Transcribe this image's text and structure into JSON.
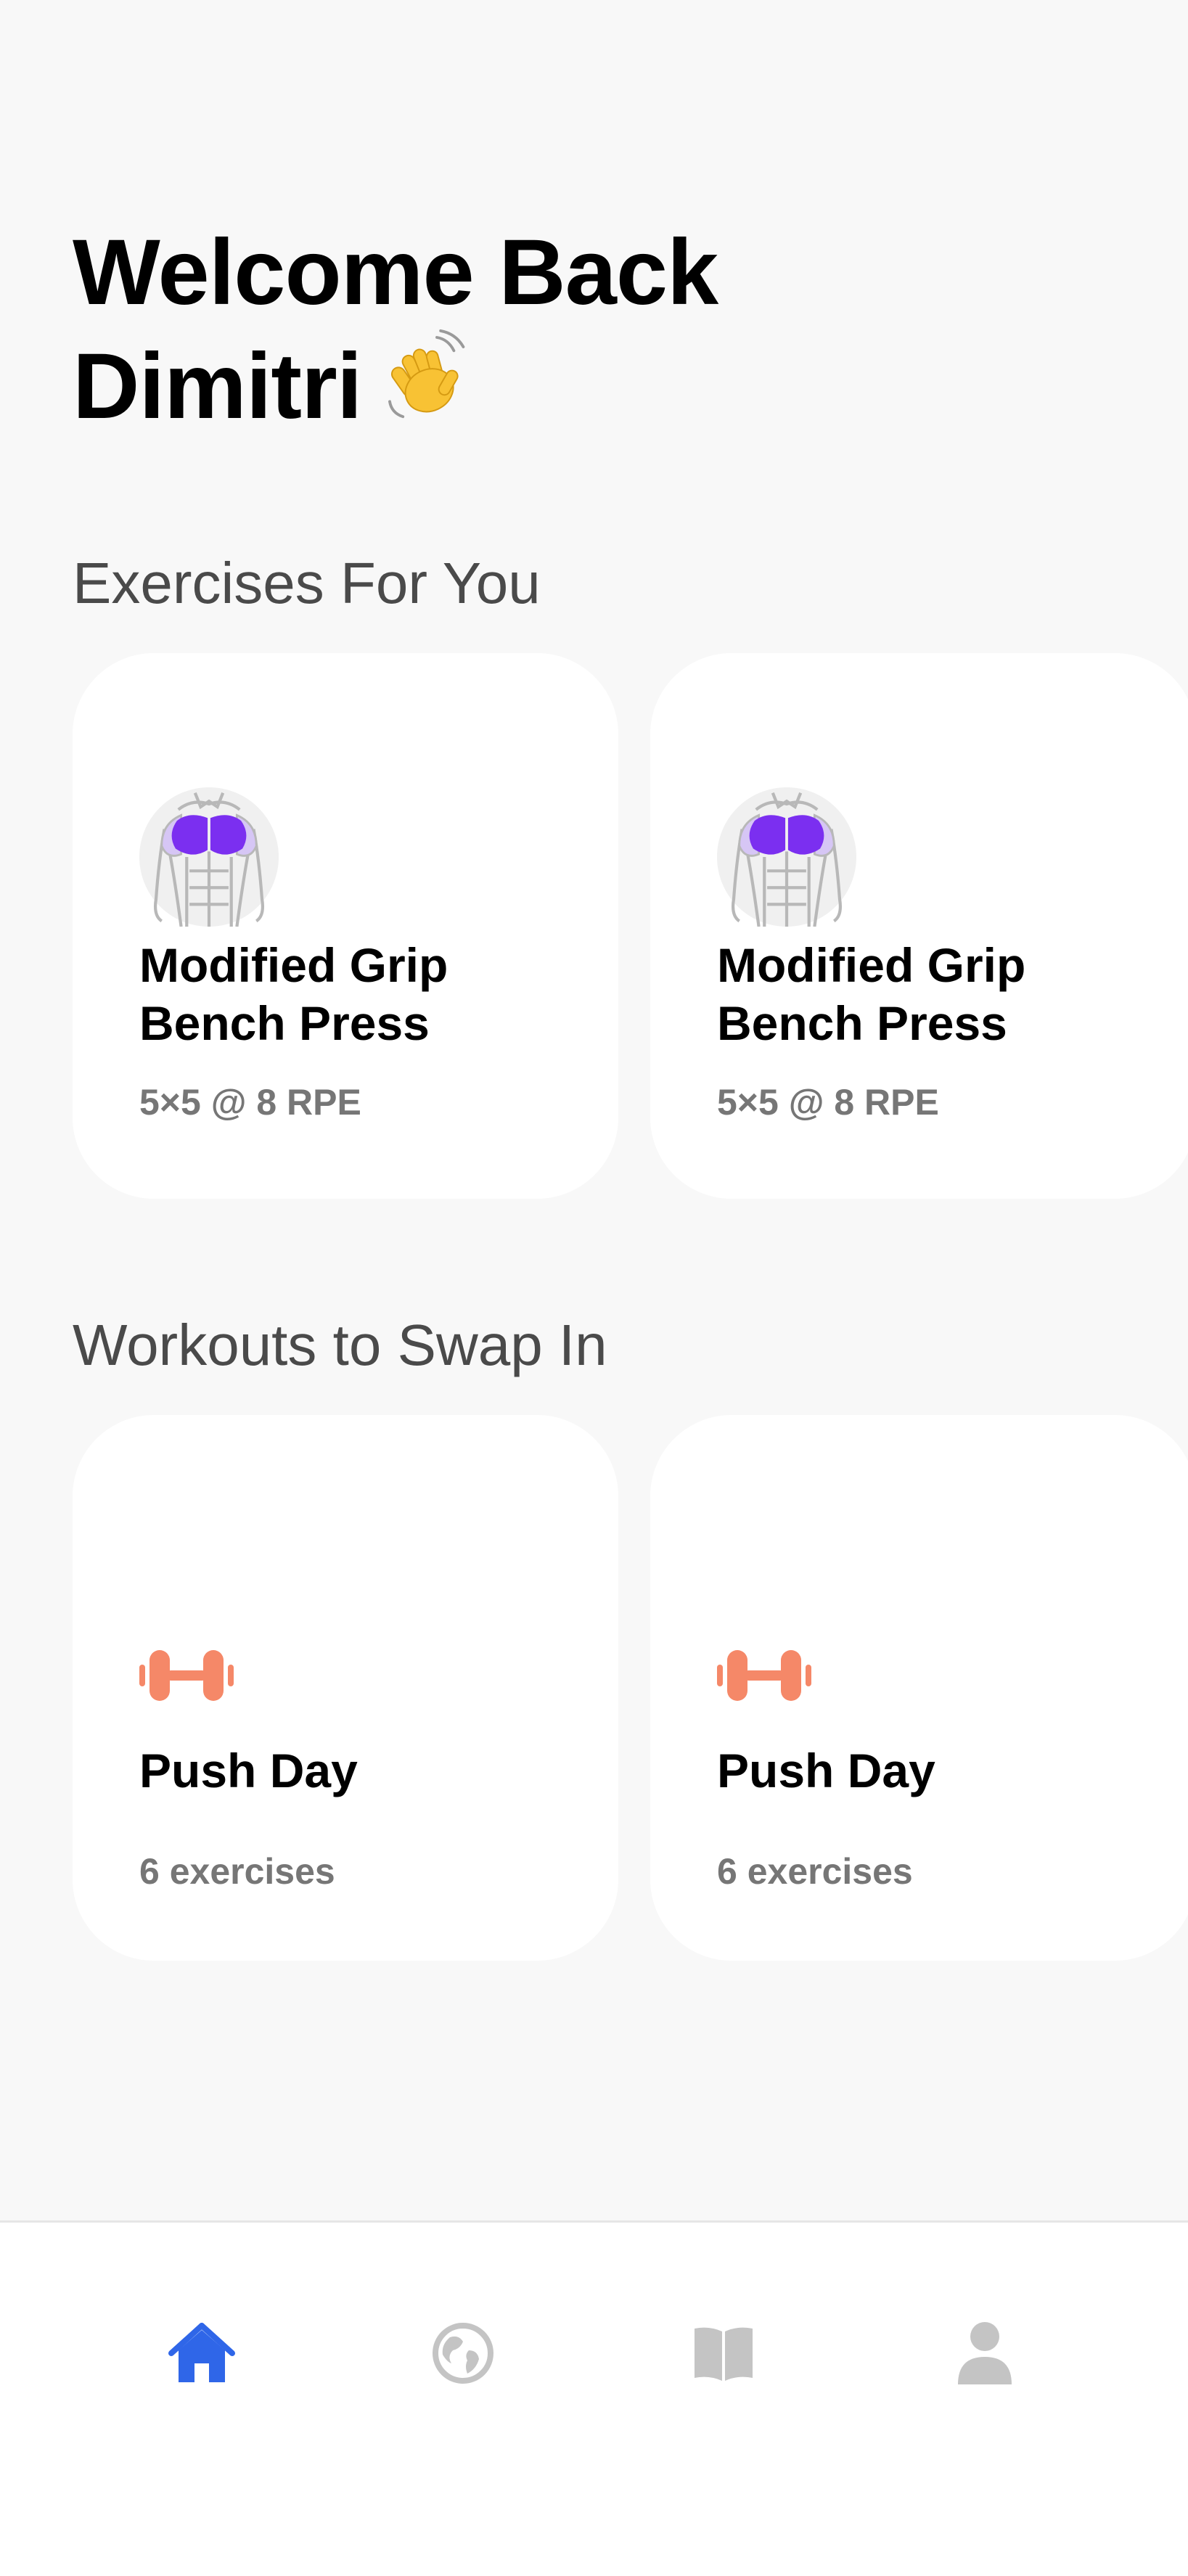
{
  "header": {
    "welcome_line1": "Welcome Back",
    "welcome_line2": "Dimitri",
    "wave_emoji": "👋"
  },
  "exercises_section": {
    "title": "Exercises For You",
    "cards": [
      {
        "title_line1": "Modified Grip",
        "title_line2": "Bench Press",
        "detail": "5×5 @ 8 RPE",
        "icon": "chest-muscle-icon"
      },
      {
        "title_line1": "Modified Grip",
        "title_line2": "Bench Press",
        "detail": "5×5 @ 8 RPE",
        "icon": "chest-muscle-icon"
      }
    ]
  },
  "workouts_section": {
    "title": "Workouts to Swap In",
    "cards": [
      {
        "title": "Push Day",
        "detail": "6 exercises",
        "icon": "dumbbell-icon"
      },
      {
        "title": "Push Day",
        "detail": "6 exercises",
        "icon": "dumbbell-icon"
      }
    ]
  },
  "tabbar": {
    "active": "home",
    "tabs": [
      {
        "name": "home",
        "icon": "home-icon"
      },
      {
        "name": "explore",
        "icon": "globe-icon"
      },
      {
        "name": "library",
        "icon": "book-icon"
      },
      {
        "name": "profile",
        "icon": "person-icon"
      }
    ]
  },
  "colors": {
    "background": "#f8f8f8",
    "card": "#ffffff",
    "active_tab": "#2f66e8",
    "inactive_tab": "#c4c4c4",
    "muscle_highlight": "#7b2ff0",
    "dumbbell": "#f58868",
    "subtitle_gray": "#767676",
    "section_gray": "#4a4a4a"
  }
}
